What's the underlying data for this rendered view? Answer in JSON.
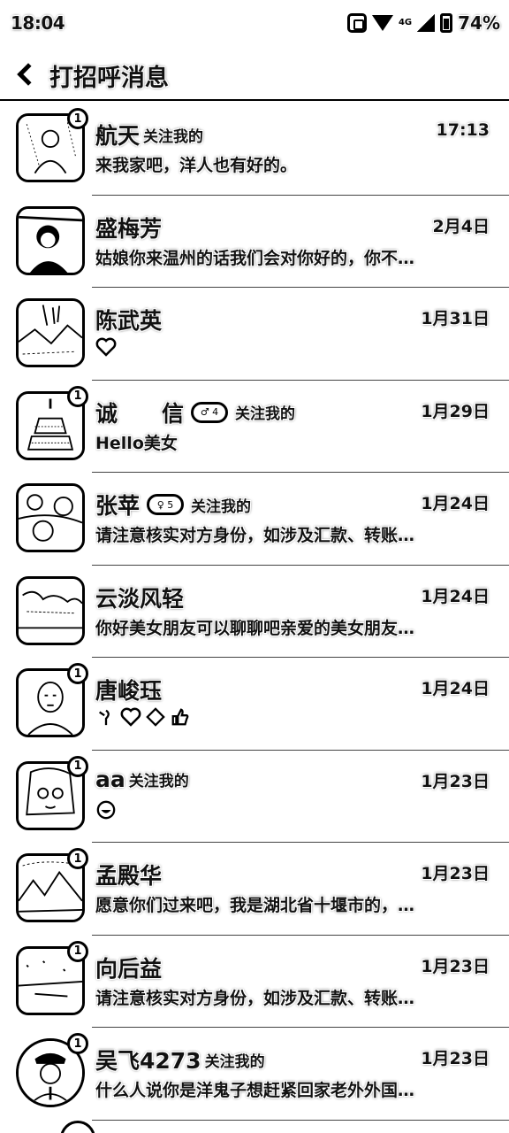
{
  "status_bar": {
    "time": "18:04",
    "signal_label": "4G",
    "battery": "74%"
  },
  "header": {
    "title": "打招呼消息"
  },
  "messages": [
    {
      "name": "航天",
      "follow_tag": "关注我的",
      "time": "17:13",
      "preview": "来我家吧，洋人也有好的。",
      "badge": "1",
      "avatar": "portrait-sketch"
    },
    {
      "name": "盛梅芳",
      "follow_tag": "",
      "time": "2月4日",
      "preview": "姑娘你来温州的话我们会对你好的，你不…",
      "badge": "",
      "avatar": "woman-portrait"
    },
    {
      "name": "陈武英",
      "follow_tag": "",
      "time": "1月31日",
      "preview": "",
      "badge": "",
      "avatar": "landscape",
      "emoji": "heart"
    },
    {
      "name": "诚　　信",
      "follow_tag": "关注我的",
      "time": "1月29日",
      "preview": "Hello美女",
      "badge": "1",
      "avatar": "cake",
      "pill": "♂ 4"
    },
    {
      "name": "张苹",
      "follow_tag": "关注我的",
      "time": "1月24日",
      "preview": "请注意核实对方身份，如涉及汇款、转账…",
      "badge": "",
      "avatar": "flowers",
      "pill": "♀ 5"
    },
    {
      "name": "云淡风轻",
      "follow_tag": "",
      "time": "1月24日",
      "preview": "你好美女朋友可以聊聊吧亲爱的美女朋友…",
      "badge": "",
      "avatar": "scenery"
    },
    {
      "name": "唐峻珏",
      "follow_tag": "",
      "time": "1月24日",
      "preview": "",
      "badge": "1",
      "avatar": "man-portrait",
      "emoji": "rose-hearts-thumb"
    },
    {
      "name": "aa",
      "follow_tag": "关注我的",
      "time": "1月23日",
      "preview": "",
      "badge": "1",
      "avatar": "woman-glasses",
      "emoji": "grin"
    },
    {
      "name": "孟殿华",
      "follow_tag": "",
      "time": "1月23日",
      "preview": "愿意你们过来吧，我是湖北省十堰市的，…",
      "badge": "1",
      "avatar": "mountains"
    },
    {
      "name": "向后益",
      "follow_tag": "",
      "time": "1月23日",
      "preview": "请注意核实对方身份，如涉及汇款、转账…",
      "badge": "1",
      "avatar": "snow-scene"
    },
    {
      "name": "吴飞4273",
      "follow_tag": "关注我的",
      "time": "1月23日",
      "preview": "什么人说你是洋鬼子想赶紧回家老外外国…",
      "badge": "1",
      "avatar": "officer"
    }
  ]
}
